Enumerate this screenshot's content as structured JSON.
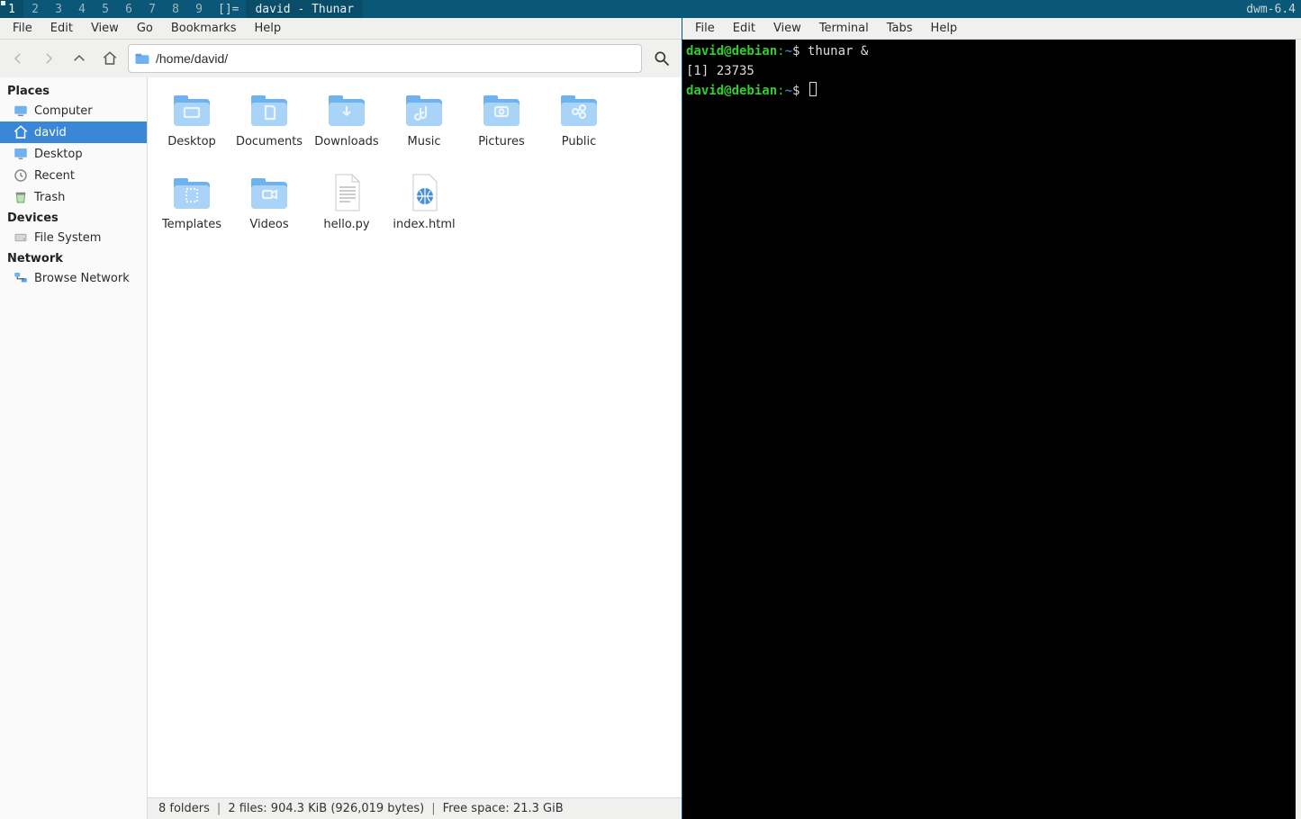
{
  "dwm": {
    "tags": [
      "1",
      "2",
      "3",
      "4",
      "5",
      "6",
      "7",
      "8",
      "9"
    ],
    "active_tag_index": 0,
    "layout_symbol": "[]=",
    "title": "david - Thunar",
    "status": "dwm-6.4"
  },
  "thunar": {
    "menu": [
      "File",
      "Edit",
      "View",
      "Go",
      "Bookmarks",
      "Help"
    ],
    "location": "/home/david/",
    "sidebar": {
      "sections": [
        {
          "title": "Places",
          "items": [
            {
              "label": "Computer",
              "icon": "computer"
            },
            {
              "label": "david",
              "icon": "home",
              "selected": true
            },
            {
              "label": "Desktop",
              "icon": "desktop"
            },
            {
              "label": "Recent",
              "icon": "recent"
            },
            {
              "label": "Trash",
              "icon": "trash"
            }
          ]
        },
        {
          "title": "Devices",
          "items": [
            {
              "label": "File System",
              "icon": "drive"
            }
          ]
        },
        {
          "title": "Network",
          "items": [
            {
              "label": "Browse Network",
              "icon": "network"
            }
          ]
        }
      ]
    },
    "files": [
      {
        "label": "Desktop",
        "type": "folder",
        "glyph": "desktop"
      },
      {
        "label": "Documents",
        "type": "folder",
        "glyph": "document"
      },
      {
        "label": "Downloads",
        "type": "folder",
        "glyph": "download"
      },
      {
        "label": "Music",
        "type": "folder",
        "glyph": "music"
      },
      {
        "label": "Pictures",
        "type": "folder",
        "glyph": "pictures"
      },
      {
        "label": "Public",
        "type": "folder",
        "glyph": "public"
      },
      {
        "label": "Templates",
        "type": "folder",
        "glyph": "templates"
      },
      {
        "label": "Videos",
        "type": "folder",
        "glyph": "videos"
      },
      {
        "label": "hello.py",
        "type": "file",
        "glyph": "text"
      },
      {
        "label": "index.html",
        "type": "file",
        "glyph": "html"
      }
    ],
    "status": {
      "folders": "8 folders",
      "files": "2 files: 904.3 KiB (926,019 bytes)",
      "freespace": "Free space: 21.3 GiB"
    }
  },
  "terminal": {
    "menu": [
      "File",
      "Edit",
      "View",
      "Terminal",
      "Tabs",
      "Help"
    ],
    "prompt": {
      "user": "david@debian",
      "path": "~",
      "symbol": "$"
    },
    "lines": [
      {
        "type": "cmd",
        "text": "thunar &"
      },
      {
        "type": "out",
        "text": "[1] 23735"
      },
      {
        "type": "cmd",
        "text": ""
      }
    ]
  }
}
